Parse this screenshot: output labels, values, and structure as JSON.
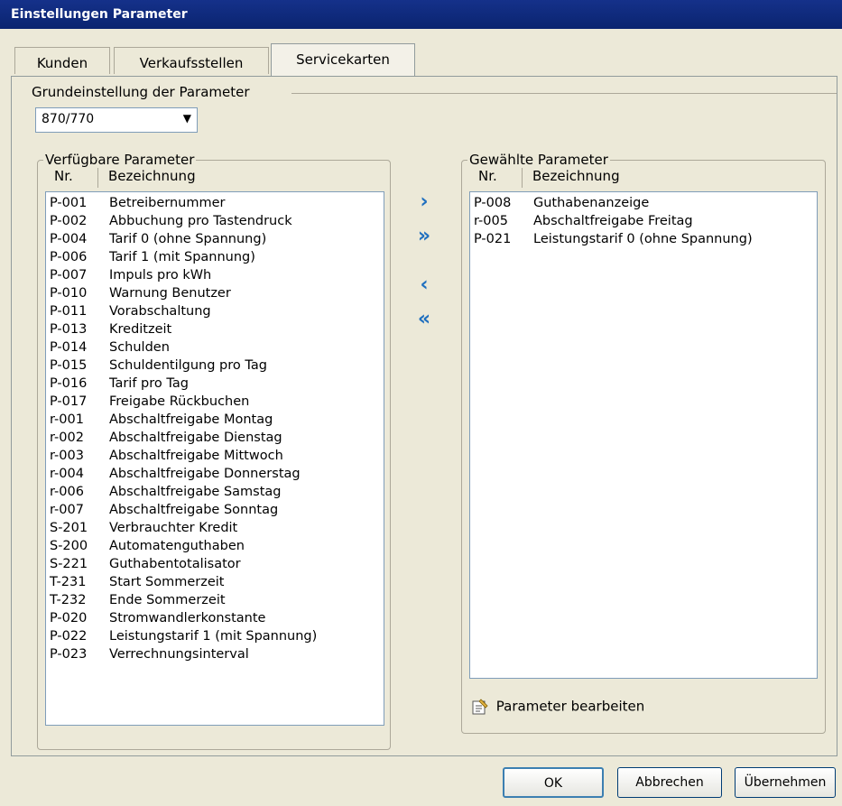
{
  "window": {
    "title": "Einstellungen Parameter"
  },
  "tabs": [
    {
      "label": "Kunden"
    },
    {
      "label": "Verkaufsstellen"
    },
    {
      "label": "Servicekarten",
      "active": true
    }
  ],
  "grundeinstellung": {
    "label": "Grundeinstellung der Parameter",
    "selected_value": "870/770"
  },
  "available": {
    "title": "Verfügbare Parameter",
    "col_nr": "Nr.",
    "col_bez": "Bezeichnung",
    "items": [
      {
        "nr": "P-001",
        "name": "Betreibernummer"
      },
      {
        "nr": "P-002",
        "name": "Abbuchung pro Tastendruck"
      },
      {
        "nr": "P-004",
        "name": "Tarif 0 (ohne Spannung)"
      },
      {
        "nr": "P-006",
        "name": "Tarif 1 (mit Spannung)"
      },
      {
        "nr": "P-007",
        "name": "Impuls pro kWh"
      },
      {
        "nr": "P-010",
        "name": "Warnung Benutzer"
      },
      {
        "nr": "P-011",
        "name": "Vorabschaltung"
      },
      {
        "nr": "P-013",
        "name": "Kreditzeit"
      },
      {
        "nr": "P-014",
        "name": "Schulden"
      },
      {
        "nr": "P-015",
        "name": "Schuldentilgung pro Tag"
      },
      {
        "nr": "P-016",
        "name": "Tarif pro Tag"
      },
      {
        "nr": "P-017",
        "name": "Freigabe Rückbuchen"
      },
      {
        "nr": "r-001",
        "name": "Abschaltfreigabe Montag"
      },
      {
        "nr": "r-002",
        "name": "Abschaltfreigabe Dienstag"
      },
      {
        "nr": "r-003",
        "name": "Abschaltfreigabe Mittwoch"
      },
      {
        "nr": "r-004",
        "name": "Abschaltfreigabe Donnerstag"
      },
      {
        "nr": "r-006",
        "name": "Abschaltfreigabe Samstag"
      },
      {
        "nr": "r-007",
        "name": "Abschaltfreigabe Sonntag"
      },
      {
        "nr": "S-201",
        "name": "Verbrauchter Kredit"
      },
      {
        "nr": "S-200",
        "name": "Automatenguthaben"
      },
      {
        "nr": "S-221",
        "name": "Guthabentotalisator"
      },
      {
        "nr": "T-231",
        "name": "Start Sommerzeit"
      },
      {
        "nr": "T-232",
        "name": "Ende Sommerzeit"
      },
      {
        "nr": "P-020",
        "name": "Stromwandlerkonstante"
      },
      {
        "nr": "P-022",
        "name": "Leistungstarif 1 (mit Spannung)"
      },
      {
        "nr": "P-023",
        "name": "Verrechnungsinterval"
      }
    ]
  },
  "transfer": {
    "add_one": "›",
    "add_all": "»",
    "remove_one": "‹",
    "remove_all": "«"
  },
  "selected": {
    "title": "Gewählte Parameter",
    "col_nr": "Nr.",
    "col_bez": "Bezeichnung",
    "items": [
      {
        "nr": "P-008",
        "name": "Guthabenanzeige"
      },
      {
        "nr": "r-005",
        "name": "Abschaltfreigabe Freitag"
      },
      {
        "nr": "P-021",
        "name": "Leistungstarif 0 (ohne Spannung)"
      }
    ],
    "edit_label": "Parameter bearbeiten"
  },
  "footer": {
    "ok": "OK",
    "cancel": "Abbrechen",
    "apply": "Übernehmen"
  },
  "colors": {
    "title_bar": "#0a2470",
    "arrow_blue": "#1f6fbf"
  }
}
